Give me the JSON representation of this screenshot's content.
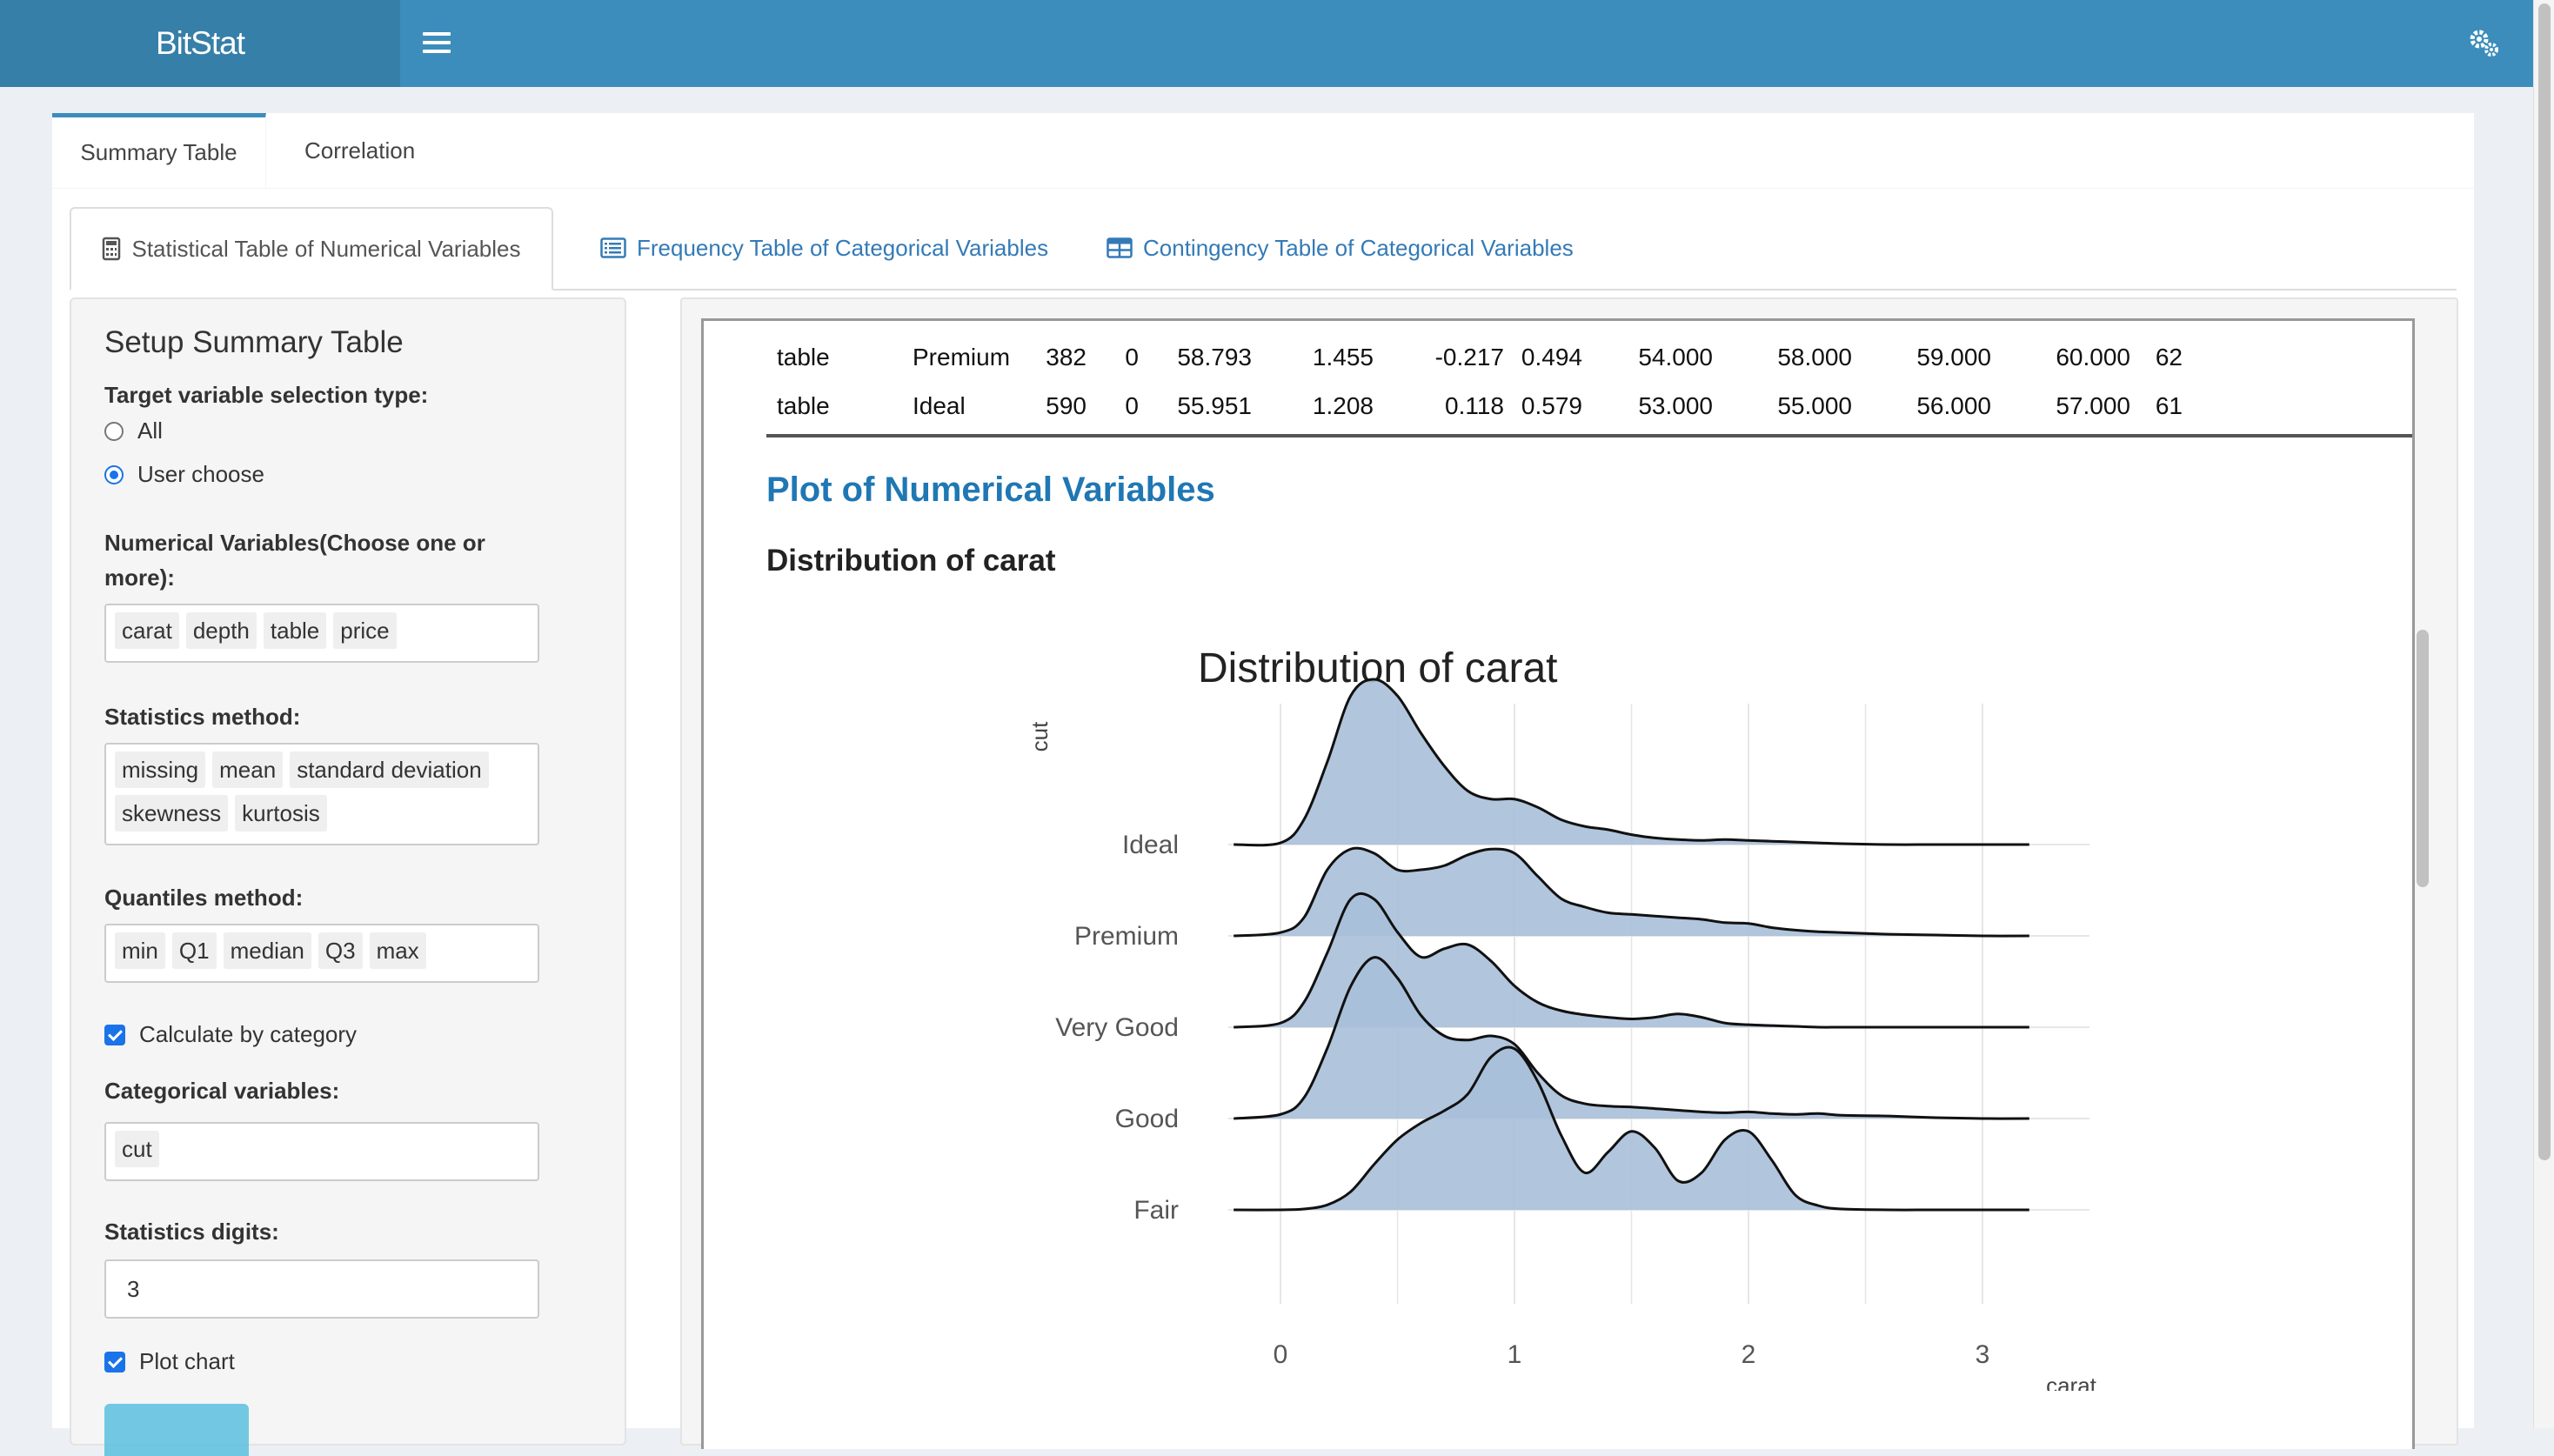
{
  "app": {
    "title": "BitStat"
  },
  "top_tabs": [
    {
      "label": "Summary Table",
      "active": true
    },
    {
      "label": "Correlation",
      "active": false
    }
  ],
  "sub_tabs": [
    {
      "label": "Statistical Table of Numerical Variables",
      "icon": "calculator-icon",
      "active": true
    },
    {
      "label": "Frequency Table of Categorical Variables",
      "icon": "list-icon",
      "active": false
    },
    {
      "label": "Contingency Table of Categorical Variables",
      "icon": "table-icon",
      "active": false
    }
  ],
  "setup": {
    "title": "Setup Summary Table",
    "target_label": "Target variable selection type:",
    "target_options": [
      "All",
      "User choose"
    ],
    "target_selected": "User choose",
    "numvars_label": "Numerical Variables(Choose one or more):",
    "numvars": [
      "carat",
      "depth",
      "table",
      "price"
    ],
    "stats_label": "Statistics method:",
    "stats": [
      "missing",
      "mean",
      "standard deviation",
      "skewness",
      "kurtosis"
    ],
    "quant_label": "Quantiles method:",
    "quantiles": [
      "min",
      "Q1",
      "median",
      "Q3",
      "max"
    ],
    "calc_by_cat_label": "Calculate by category",
    "calc_by_cat": true,
    "catvars_label": "Categorical variables:",
    "catvars": [
      "cut"
    ],
    "digits_label": "Statistics digits:",
    "digits": "3",
    "plot_chart_label": "Plot chart",
    "plot_chart": true
  },
  "stats_table": {
    "rows": [
      [
        "table",
        "Premium",
        "382",
        "0",
        "58.793",
        "1.455",
        "-0.217",
        "0.494",
        "54.000",
        "58.000",
        "59.000",
        "60.000",
        "62"
      ],
      [
        "table",
        "Ideal",
        "590",
        "0",
        "55.951",
        "1.208",
        "0.118",
        "0.579",
        "53.000",
        "55.000",
        "56.000",
        "57.000",
        "61"
      ]
    ]
  },
  "plot_section": {
    "heading": "Plot of Numerical Variables",
    "subheading": "Distribution of carat"
  },
  "colors": {
    "accent": "#3c8dbc",
    "ridge_fill": "#a9bfd9",
    "link": "#337ab7"
  },
  "chart_data": {
    "type": "area",
    "subtype": "ridgeline",
    "title": "Distribution of carat",
    "xlabel": "carat",
    "ylabel": "cut",
    "xlim": [
      -0.2,
      3.2
    ],
    "xticks": [
      0,
      1,
      2,
      3
    ],
    "categories": [
      "Fair",
      "Good",
      "Very Good",
      "Premium",
      "Ideal"
    ],
    "x": [
      -0.2,
      0.0,
      0.1,
      0.2,
      0.3,
      0.4,
      0.5,
      0.6,
      0.7,
      0.8,
      0.9,
      1.0,
      1.1,
      1.2,
      1.3,
      1.4,
      1.5,
      1.6,
      1.7,
      1.8,
      1.9,
      2.0,
      2.1,
      2.2,
      2.3,
      2.4,
      2.6,
      2.8,
      3.0,
      3.2
    ],
    "series": [
      {
        "name": "Fair",
        "values": [
          0,
          0,
          0.01,
          0.06,
          0.22,
          0.55,
          0.85,
          1.05,
          1.2,
          1.4,
          1.85,
          1.95,
          1.55,
          0.9,
          0.45,
          0.7,
          0.95,
          0.75,
          0.35,
          0.45,
          0.85,
          0.95,
          0.6,
          0.18,
          0.05,
          0.01,
          0,
          0,
          0,
          0
        ]
      },
      {
        "name": "Good",
        "values": [
          0,
          0.05,
          0.25,
          0.85,
          1.6,
          1.95,
          1.7,
          1.25,
          1.0,
          0.95,
          1.0,
          0.9,
          0.55,
          0.28,
          0.18,
          0.15,
          0.14,
          0.12,
          0.1,
          0.08,
          0.07,
          0.08,
          0.06,
          0.05,
          0.06,
          0.04,
          0.03,
          0.01,
          0,
          0
        ]
      },
      {
        "name": "Very Good",
        "values": [
          0,
          0.05,
          0.3,
          0.9,
          1.55,
          1.55,
          1.15,
          0.85,
          0.95,
          1.0,
          0.8,
          0.5,
          0.3,
          0.2,
          0.15,
          0.12,
          0.1,
          0.12,
          0.16,
          0.12,
          0.05,
          0.03,
          0.02,
          0.01,
          0,
          0,
          0,
          0,
          0,
          0
        ]
      },
      {
        "name": "Premium",
        "values": [
          0,
          0.04,
          0.22,
          0.8,
          1.05,
          1.0,
          0.8,
          0.8,
          0.85,
          0.98,
          1.05,
          1.0,
          0.72,
          0.45,
          0.35,
          0.28,
          0.26,
          0.24,
          0.22,
          0.2,
          0.16,
          0.15,
          0.1,
          0.07,
          0.05,
          0.04,
          0.02,
          0.01,
          0,
          0
        ]
      },
      {
        "name": "Ideal",
        "values": [
          0,
          0.02,
          0.3,
          1.0,
          1.8,
          2.0,
          1.8,
          1.35,
          0.95,
          0.65,
          0.55,
          0.55,
          0.45,
          0.3,
          0.22,
          0.18,
          0.12,
          0.08,
          0.06,
          0.05,
          0.06,
          0.05,
          0.04,
          0.03,
          0.02,
          0.01,
          0,
          0,
          0,
          0
        ]
      }
    ]
  }
}
